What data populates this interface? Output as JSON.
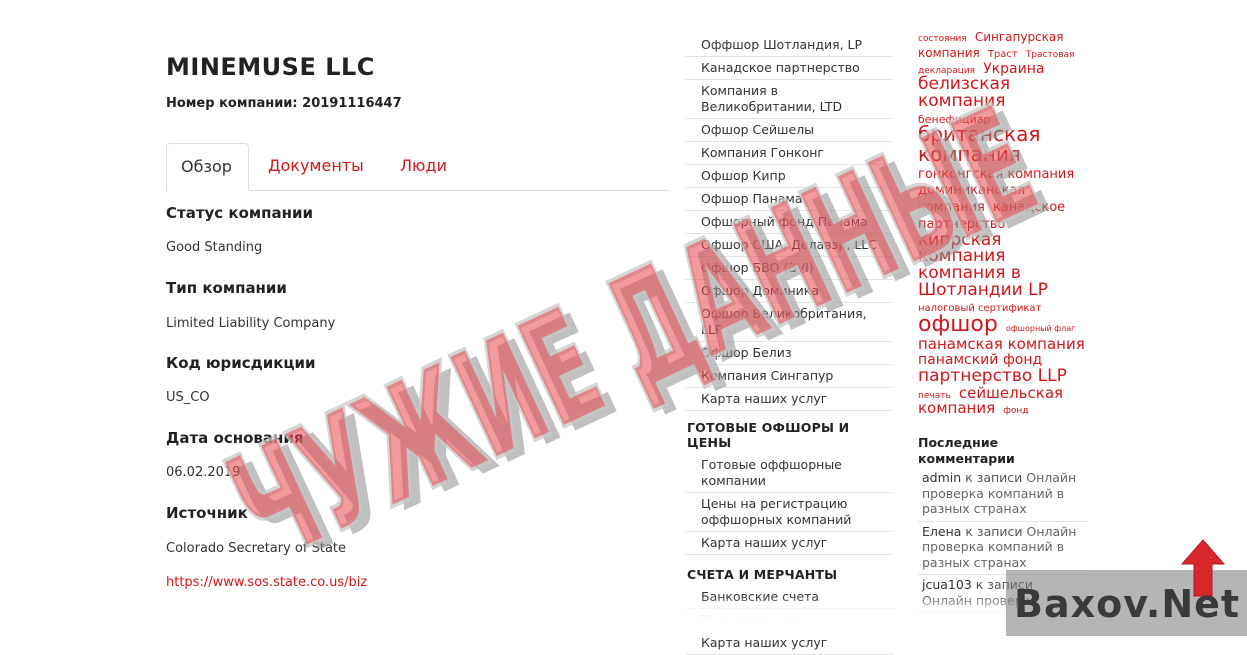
{
  "company": {
    "name": "MINEMUSE LLC",
    "regno": "Номер компании: 20191116447"
  },
  "tabs": [
    {
      "label": "Обзор",
      "active": true
    },
    {
      "label": "Документы",
      "active": false
    },
    {
      "label": "Люди",
      "active": false
    }
  ],
  "fields": {
    "status_label": "Статус компании",
    "status_value": "Good Standing",
    "type_label": "Тип компании",
    "type_value": "Limited Liability Company",
    "jur_label": "Код юрисдикции",
    "jur_value": "US_CO",
    "date_label": "Дата основания",
    "date_value": "06.02.2019",
    "source_label": "Источник",
    "source_value": "Colorado Secretary of State",
    "source_link": "https://www.sos.state.co.us/biz"
  },
  "menu": {
    "items_top": [
      "Оффшор Шотландия, LP",
      "Канадское партнерство",
      "Компания в Великобритании, LTD",
      "Офшор Сейшелы",
      "Компания Гонконг",
      "Офшор Кипр",
      "Офшор Панама",
      "Офшорный фонд Панама",
      "Офшор США, Делавэр, LLC",
      "Офшор БВО (BVI)",
      "Офшор Доминика",
      "Офшор Великобритания, LLP",
      "Офшор Белиз",
      "Компания Сингапур",
      "Карта наших услуг"
    ],
    "heading_ready": "ГОТОВЫЕ ОФШОРЫ И ЦЕНЫ",
    "items_ready": [
      "Готовые оффшорные компании",
      "Цены на регистрацию оффшорных компаний",
      "Карта наших услуг"
    ],
    "heading_accounts": "СЧЕТА И МЕРЧАНТЫ",
    "items_accounts": [
      "Банковские счета",
      "Мерчант счета",
      "Карта наших услуг"
    ]
  },
  "tag_cloud": [
    {
      "text": "состояния",
      "size": 9
    },
    {
      "text": "Сингапурская компания",
      "size": 12
    },
    {
      "text": "Траст",
      "size": 10
    },
    {
      "text": "Трастовая декларация",
      "size": 9
    },
    {
      "text": "Украина",
      "size": 14
    },
    {
      "text": "белизская компания",
      "size": 17
    },
    {
      "text": "бенефициар",
      "size": 11
    },
    {
      "text": "британская компания",
      "size": 20
    },
    {
      "text": "гонконгская компания",
      "size": 13
    },
    {
      "text": "доминиканская компания",
      "size": 13
    },
    {
      "text": "канадское партнерство",
      "size": 13
    },
    {
      "text": "кипрская компания",
      "size": 17
    },
    {
      "text": "компания в Шотландии LP",
      "size": 17
    },
    {
      "text": "налоговый сертификат",
      "size": 10
    },
    {
      "text": "офшор",
      "size": 22
    },
    {
      "text": "офшорный флаг",
      "size": 8
    },
    {
      "text": "панамская компания",
      "size": 15
    },
    {
      "text": "панамский фонд",
      "size": 14
    },
    {
      "text": "партнерство LLP",
      "size": 17
    },
    {
      "text": "печать",
      "size": 9
    },
    {
      "text": "сейшельская компания",
      "size": 15
    },
    {
      "text": "фонд",
      "size": 9
    }
  ],
  "recent": {
    "heading": "Последние комментарии",
    "items": [
      {
        "author": "admin",
        "sep": " к записи ",
        "title": "Онлайн проверка компаний в разных странах"
      },
      {
        "author": "Елена",
        "sep": " к записи ",
        "title": "Онлайн проверка компаний в разных странах"
      },
      {
        "author": "jcua103",
        "sep": " к записи ",
        "title": "Онлайн проверка"
      }
    ]
  },
  "stamp_text": "ЧУЖИЕ ДАННЫЕ",
  "watermark": "Baxov.Net",
  "colors": {
    "accent": "#d0181b",
    "stamp": "#e8474f",
    "text": "#222222"
  }
}
